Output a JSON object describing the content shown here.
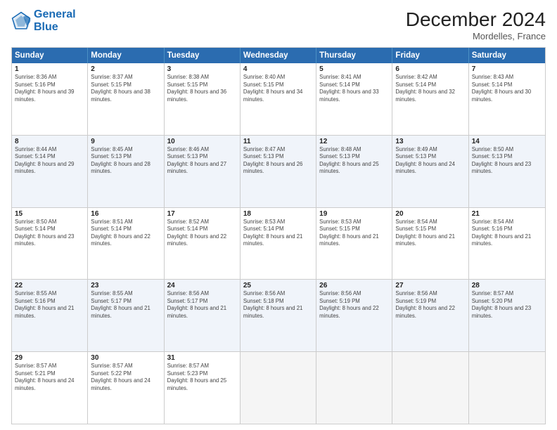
{
  "header": {
    "logo_line1": "General",
    "logo_line2": "Blue",
    "month_title": "December 2024",
    "location": "Mordelles, France"
  },
  "days_of_week": [
    "Sunday",
    "Monday",
    "Tuesday",
    "Wednesday",
    "Thursday",
    "Friday",
    "Saturday"
  ],
  "weeks": [
    [
      {
        "day": "1",
        "sunrise": "8:36 AM",
        "sunset": "5:16 PM",
        "daylight": "8 hours and 39 minutes."
      },
      {
        "day": "2",
        "sunrise": "8:37 AM",
        "sunset": "5:15 PM",
        "daylight": "8 hours and 38 minutes."
      },
      {
        "day": "3",
        "sunrise": "8:38 AM",
        "sunset": "5:15 PM",
        "daylight": "8 hours and 36 minutes."
      },
      {
        "day": "4",
        "sunrise": "8:40 AM",
        "sunset": "5:15 PM",
        "daylight": "8 hours and 34 minutes."
      },
      {
        "day": "5",
        "sunrise": "8:41 AM",
        "sunset": "5:14 PM",
        "daylight": "8 hours and 33 minutes."
      },
      {
        "day": "6",
        "sunrise": "8:42 AM",
        "sunset": "5:14 PM",
        "daylight": "8 hours and 32 minutes."
      },
      {
        "day": "7",
        "sunrise": "8:43 AM",
        "sunset": "5:14 PM",
        "daylight": "8 hours and 30 minutes."
      }
    ],
    [
      {
        "day": "8",
        "sunrise": "8:44 AM",
        "sunset": "5:14 PM",
        "daylight": "8 hours and 29 minutes."
      },
      {
        "day": "9",
        "sunrise": "8:45 AM",
        "sunset": "5:13 PM",
        "daylight": "8 hours and 28 minutes."
      },
      {
        "day": "10",
        "sunrise": "8:46 AM",
        "sunset": "5:13 PM",
        "daylight": "8 hours and 27 minutes."
      },
      {
        "day": "11",
        "sunrise": "8:47 AM",
        "sunset": "5:13 PM",
        "daylight": "8 hours and 26 minutes."
      },
      {
        "day": "12",
        "sunrise": "8:48 AM",
        "sunset": "5:13 PM",
        "daylight": "8 hours and 25 minutes."
      },
      {
        "day": "13",
        "sunrise": "8:49 AM",
        "sunset": "5:13 PM",
        "daylight": "8 hours and 24 minutes."
      },
      {
        "day": "14",
        "sunrise": "8:50 AM",
        "sunset": "5:13 PM",
        "daylight": "8 hours and 23 minutes."
      }
    ],
    [
      {
        "day": "15",
        "sunrise": "8:50 AM",
        "sunset": "5:14 PM",
        "daylight": "8 hours and 23 minutes."
      },
      {
        "day": "16",
        "sunrise": "8:51 AM",
        "sunset": "5:14 PM",
        "daylight": "8 hours and 22 minutes."
      },
      {
        "day": "17",
        "sunrise": "8:52 AM",
        "sunset": "5:14 PM",
        "daylight": "8 hours and 22 minutes."
      },
      {
        "day": "18",
        "sunrise": "8:53 AM",
        "sunset": "5:14 PM",
        "daylight": "8 hours and 21 minutes."
      },
      {
        "day": "19",
        "sunrise": "8:53 AM",
        "sunset": "5:15 PM",
        "daylight": "8 hours and 21 minutes."
      },
      {
        "day": "20",
        "sunrise": "8:54 AM",
        "sunset": "5:15 PM",
        "daylight": "8 hours and 21 minutes."
      },
      {
        "day": "21",
        "sunrise": "8:54 AM",
        "sunset": "5:16 PM",
        "daylight": "8 hours and 21 minutes."
      }
    ],
    [
      {
        "day": "22",
        "sunrise": "8:55 AM",
        "sunset": "5:16 PM",
        "daylight": "8 hours and 21 minutes."
      },
      {
        "day": "23",
        "sunrise": "8:55 AM",
        "sunset": "5:17 PM",
        "daylight": "8 hours and 21 minutes."
      },
      {
        "day": "24",
        "sunrise": "8:56 AM",
        "sunset": "5:17 PM",
        "daylight": "8 hours and 21 minutes."
      },
      {
        "day": "25",
        "sunrise": "8:56 AM",
        "sunset": "5:18 PM",
        "daylight": "8 hours and 21 minutes."
      },
      {
        "day": "26",
        "sunrise": "8:56 AM",
        "sunset": "5:19 PM",
        "daylight": "8 hours and 22 minutes."
      },
      {
        "day": "27",
        "sunrise": "8:56 AM",
        "sunset": "5:19 PM",
        "daylight": "8 hours and 22 minutes."
      },
      {
        "day": "28",
        "sunrise": "8:57 AM",
        "sunset": "5:20 PM",
        "daylight": "8 hours and 23 minutes."
      }
    ],
    [
      {
        "day": "29",
        "sunrise": "8:57 AM",
        "sunset": "5:21 PM",
        "daylight": "8 hours and 24 minutes."
      },
      {
        "day": "30",
        "sunrise": "8:57 AM",
        "sunset": "5:22 PM",
        "daylight": "8 hours and 24 minutes."
      },
      {
        "day": "31",
        "sunrise": "8:57 AM",
        "sunset": "5:23 PM",
        "daylight": "8 hours and 25 minutes."
      },
      null,
      null,
      null,
      null
    ]
  ]
}
